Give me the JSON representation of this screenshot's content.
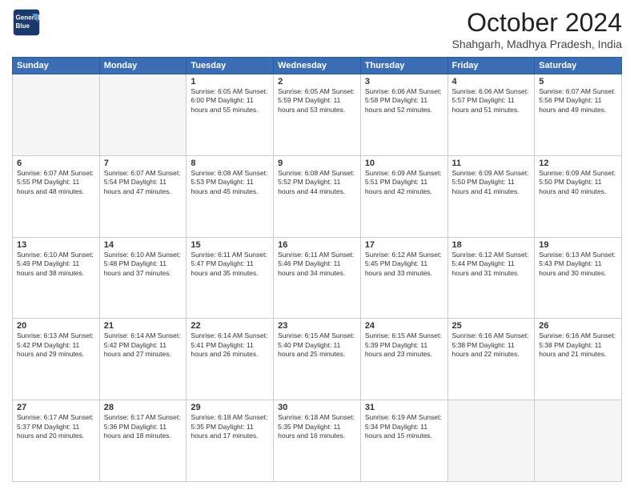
{
  "header": {
    "logo_line1": "General",
    "logo_line2": "Blue",
    "month": "October 2024",
    "location": "Shahgarh, Madhya Pradesh, India"
  },
  "weekdays": [
    "Sunday",
    "Monday",
    "Tuesday",
    "Wednesday",
    "Thursday",
    "Friday",
    "Saturday"
  ],
  "weeks": [
    [
      {
        "day": "",
        "info": ""
      },
      {
        "day": "",
        "info": ""
      },
      {
        "day": "1",
        "info": "Sunrise: 6:05 AM\nSunset: 6:00 PM\nDaylight: 11 hours and 55 minutes."
      },
      {
        "day": "2",
        "info": "Sunrise: 6:05 AM\nSunset: 5:59 PM\nDaylight: 11 hours and 53 minutes."
      },
      {
        "day": "3",
        "info": "Sunrise: 6:06 AM\nSunset: 5:58 PM\nDaylight: 11 hours and 52 minutes."
      },
      {
        "day": "4",
        "info": "Sunrise: 6:06 AM\nSunset: 5:57 PM\nDaylight: 11 hours and 51 minutes."
      },
      {
        "day": "5",
        "info": "Sunrise: 6:07 AM\nSunset: 5:56 PM\nDaylight: 11 hours and 49 minutes."
      }
    ],
    [
      {
        "day": "6",
        "info": "Sunrise: 6:07 AM\nSunset: 5:55 PM\nDaylight: 11 hours and 48 minutes."
      },
      {
        "day": "7",
        "info": "Sunrise: 6:07 AM\nSunset: 5:54 PM\nDaylight: 11 hours and 47 minutes."
      },
      {
        "day": "8",
        "info": "Sunrise: 6:08 AM\nSunset: 5:53 PM\nDaylight: 11 hours and 45 minutes."
      },
      {
        "day": "9",
        "info": "Sunrise: 6:08 AM\nSunset: 5:52 PM\nDaylight: 11 hours and 44 minutes."
      },
      {
        "day": "10",
        "info": "Sunrise: 6:09 AM\nSunset: 5:51 PM\nDaylight: 11 hours and 42 minutes."
      },
      {
        "day": "11",
        "info": "Sunrise: 6:09 AM\nSunset: 5:50 PM\nDaylight: 11 hours and 41 minutes."
      },
      {
        "day": "12",
        "info": "Sunrise: 6:09 AM\nSunset: 5:50 PM\nDaylight: 11 hours and 40 minutes."
      }
    ],
    [
      {
        "day": "13",
        "info": "Sunrise: 6:10 AM\nSunset: 5:49 PM\nDaylight: 11 hours and 38 minutes."
      },
      {
        "day": "14",
        "info": "Sunrise: 6:10 AM\nSunset: 5:48 PM\nDaylight: 11 hours and 37 minutes."
      },
      {
        "day": "15",
        "info": "Sunrise: 6:11 AM\nSunset: 5:47 PM\nDaylight: 11 hours and 35 minutes."
      },
      {
        "day": "16",
        "info": "Sunrise: 6:11 AM\nSunset: 5:46 PM\nDaylight: 11 hours and 34 minutes."
      },
      {
        "day": "17",
        "info": "Sunrise: 6:12 AM\nSunset: 5:45 PM\nDaylight: 11 hours and 33 minutes."
      },
      {
        "day": "18",
        "info": "Sunrise: 6:12 AM\nSunset: 5:44 PM\nDaylight: 11 hours and 31 minutes."
      },
      {
        "day": "19",
        "info": "Sunrise: 6:13 AM\nSunset: 5:43 PM\nDaylight: 11 hours and 30 minutes."
      }
    ],
    [
      {
        "day": "20",
        "info": "Sunrise: 6:13 AM\nSunset: 5:42 PM\nDaylight: 11 hours and 29 minutes."
      },
      {
        "day": "21",
        "info": "Sunrise: 6:14 AM\nSunset: 5:42 PM\nDaylight: 11 hours and 27 minutes."
      },
      {
        "day": "22",
        "info": "Sunrise: 6:14 AM\nSunset: 5:41 PM\nDaylight: 11 hours and 26 minutes."
      },
      {
        "day": "23",
        "info": "Sunrise: 6:15 AM\nSunset: 5:40 PM\nDaylight: 11 hours and 25 minutes."
      },
      {
        "day": "24",
        "info": "Sunrise: 6:15 AM\nSunset: 5:39 PM\nDaylight: 11 hours and 23 minutes."
      },
      {
        "day": "25",
        "info": "Sunrise: 6:16 AM\nSunset: 5:38 PM\nDaylight: 11 hours and 22 minutes."
      },
      {
        "day": "26",
        "info": "Sunrise: 6:16 AM\nSunset: 5:38 PM\nDaylight: 11 hours and 21 minutes."
      }
    ],
    [
      {
        "day": "27",
        "info": "Sunrise: 6:17 AM\nSunset: 5:37 PM\nDaylight: 11 hours and 20 minutes."
      },
      {
        "day": "28",
        "info": "Sunrise: 6:17 AM\nSunset: 5:36 PM\nDaylight: 11 hours and 18 minutes."
      },
      {
        "day": "29",
        "info": "Sunrise: 6:18 AM\nSunset: 5:35 PM\nDaylight: 11 hours and 17 minutes."
      },
      {
        "day": "30",
        "info": "Sunrise: 6:18 AM\nSunset: 5:35 PM\nDaylight: 11 hours and 16 minutes."
      },
      {
        "day": "31",
        "info": "Sunrise: 6:19 AM\nSunset: 5:34 PM\nDaylight: 11 hours and 15 minutes."
      },
      {
        "day": "",
        "info": ""
      },
      {
        "day": "",
        "info": ""
      }
    ]
  ]
}
